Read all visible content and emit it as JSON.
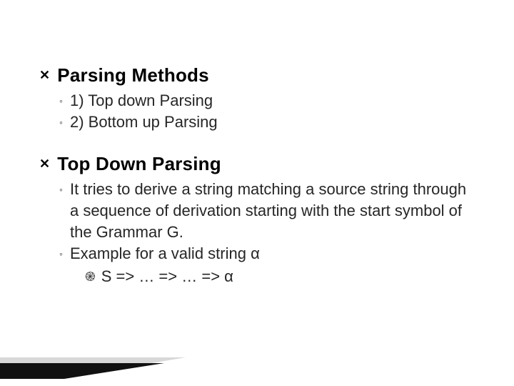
{
  "slide": {
    "items": [
      {
        "title": "Parsing Methods",
        "subs": [
          {
            "text": "1) Top down Parsing"
          },
          {
            "text": "2) Bottom up Parsing"
          }
        ]
      },
      {
        "title": "Top Down Parsing",
        "subs": [
          {
            "text": " It tries to derive a string matching a source string through a sequence of derivation starting with the start symbol of the Grammar G."
          },
          {
            "text": "Example for a valid string α",
            "subsubs": [
              {
                "text": "S => … =>  … => α"
              }
            ]
          }
        ]
      }
    ]
  },
  "bullets": {
    "level1": "✕",
    "level2": "◦",
    "level3": "֎"
  }
}
